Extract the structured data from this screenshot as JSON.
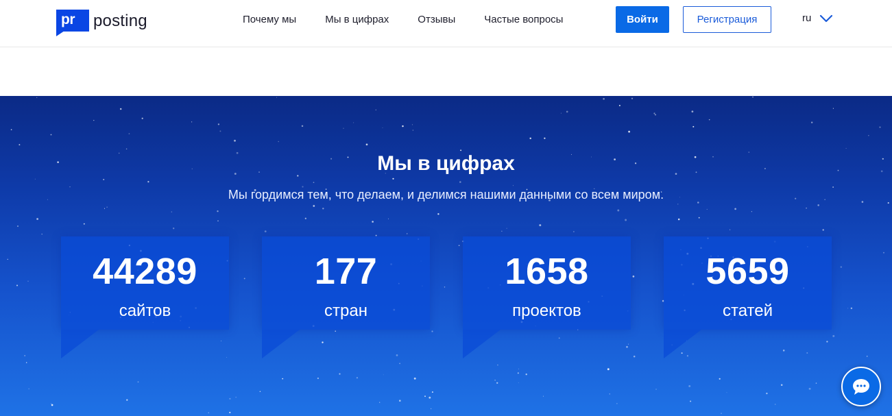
{
  "header": {
    "logo": {
      "mark": "pr",
      "text": "posting"
    },
    "nav": [
      {
        "label": "Почему мы"
      },
      {
        "label": "Мы в цифрах"
      },
      {
        "label": "Отзывы"
      },
      {
        "label": "Частые вопросы"
      }
    ],
    "login_label": "Войти",
    "register_label": "Регистрация",
    "language": {
      "selected": "ru"
    }
  },
  "stats_section": {
    "title": "Мы в цифрах",
    "subtitle": "Мы гордимся тем, что делаем, и делимся нашими данными со всем миром.",
    "items": [
      {
        "value": "44289",
        "label": "сайтов"
      },
      {
        "value": "177",
        "label": "стран"
      },
      {
        "value": "1658",
        "label": "проектов"
      },
      {
        "value": "5659",
        "label": "статей"
      }
    ]
  },
  "chat": {
    "icon": "chat-bubble-icon"
  },
  "colors": {
    "brand": "#0a46e4",
    "primary_button": "#0a6ae6",
    "hero_top": "#0b2a86",
    "hero_bottom": "#1f72e6"
  }
}
